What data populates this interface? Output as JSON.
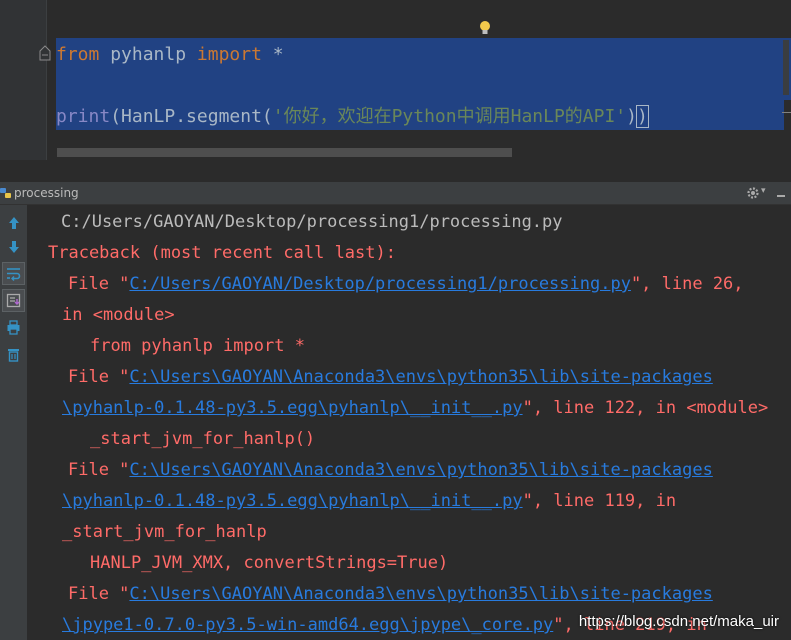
{
  "editor": {
    "line1": {
      "kw_from": "from",
      "module": " pyhanlp ",
      "kw_import": "import",
      "star": " *"
    },
    "line2": {
      "fn": "print",
      "open": "(",
      "call": "HanLP.segment(",
      "str": "'你好，欢迎在Python中调用HanLP的API'",
      "close1": ")",
      "close2": ")"
    }
  },
  "run_panel": {
    "title": "processing",
    "icons": [
      "up-arrow-icon",
      "down-arrow-icon",
      "soft-wrap-icon",
      "scroll-to-end-icon",
      "print-icon",
      "trash-icon",
      "gear-icon",
      "minimize-icon"
    ]
  },
  "console": {
    "lines": [
      {
        "segments": [
          {
            "text": "C:/Users/GAOYAN/Desktop/processing1/processing.py",
            "cls": "c-white"
          }
        ],
        "indent": 33
      },
      {
        "segments": [
          {
            "text": "Traceback (most recent call last):",
            "cls": "c-red"
          }
        ],
        "indent": 20
      },
      {
        "segments": [
          {
            "text": "File \"",
            "cls": "c-red"
          },
          {
            "text": "C:/Users/GAOYAN/Desktop/processing1/processing.py",
            "cls": "c-link"
          },
          {
            "text": "\", line 26,",
            "cls": "c-red"
          }
        ],
        "indent": 40
      },
      {
        "segments": [
          {
            "text": "in <module>",
            "cls": "c-red"
          }
        ],
        "indent": 34
      },
      {
        "segments": [
          {
            "text": "from pyhanlp import *",
            "cls": "c-red"
          }
        ],
        "indent": 62
      },
      {
        "segments": [
          {
            "text": "File \"",
            "cls": "c-red"
          },
          {
            "text": "C:\\Users\\GAOYAN\\Anaconda3\\envs\\python35\\lib\\site-packages",
            "cls": "c-link"
          }
        ],
        "indent": 40
      },
      {
        "segments": [
          {
            "text": "\\pyhanlp-0.1.48-py3.5.egg\\pyhanlp\\__init__.py",
            "cls": "c-link"
          },
          {
            "text": "\", line 122, in <module>",
            "cls": "c-red"
          }
        ],
        "indent": 34
      },
      {
        "segments": [
          {
            "text": "_start_jvm_for_hanlp()",
            "cls": "c-red"
          }
        ],
        "indent": 62
      },
      {
        "segments": [
          {
            "text": "File \"",
            "cls": "c-red"
          },
          {
            "text": "C:\\Users\\GAOYAN\\Anaconda3\\envs\\python35\\lib\\site-packages",
            "cls": "c-link"
          }
        ],
        "indent": 40
      },
      {
        "segments": [
          {
            "text": "\\pyhanlp-0.1.48-py3.5.egg\\pyhanlp\\__init__.py",
            "cls": "c-link"
          },
          {
            "text": "\", line 119, in",
            "cls": "c-red"
          }
        ],
        "indent": 34
      },
      {
        "segments": [
          {
            "text": "_start_jvm_for_hanlp",
            "cls": "c-red"
          }
        ],
        "indent": 34
      },
      {
        "segments": [
          {
            "text": "HANLP_JVM_XMX, convertStrings=True)",
            "cls": "c-red"
          }
        ],
        "indent": 62
      },
      {
        "segments": [
          {
            "text": "File \"",
            "cls": "c-red"
          },
          {
            "text": "C:\\Users\\GAOYAN\\Anaconda3\\envs\\python35\\lib\\site-packages",
            "cls": "c-link"
          }
        ],
        "indent": 40
      },
      {
        "segments": [
          {
            "text": "\\jpype1-0.7.0-py3.5-win-amd64.egg\\jpype\\_core.py",
            "cls": "c-link"
          },
          {
            "text": "\", line 219, in",
            "cls": "c-red"
          }
        ],
        "indent": 34
      }
    ]
  },
  "watermark": "https://blog.csdn.net/maka_uir"
}
